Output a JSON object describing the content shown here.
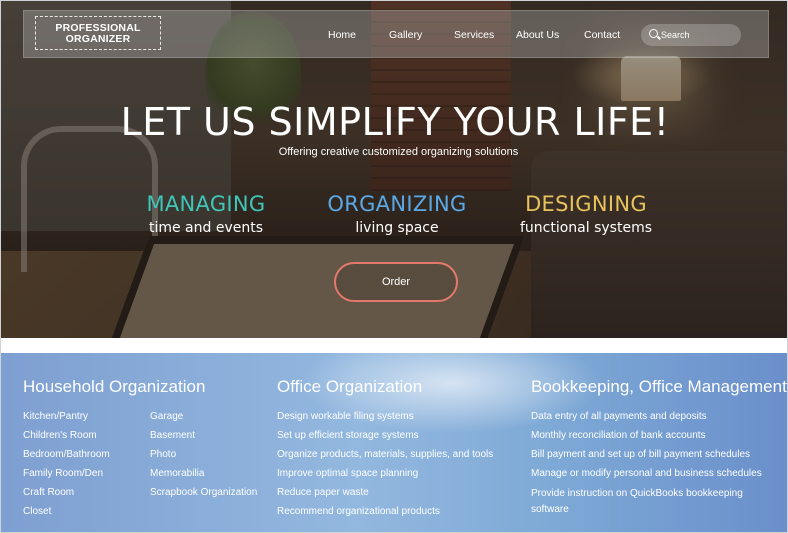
{
  "header": {
    "logo_line1": "PROFESSIONAL",
    "logo_line2": "ORGANIZER",
    "nav": [
      "Home",
      "Gallery",
      "Services",
      "About Us",
      "Contact"
    ],
    "search_placeholder": "Search"
  },
  "hero": {
    "headline": "LET US SIMPLIFY YOUR LIFE!",
    "subheadline": "Offering creative customized organizing solutions",
    "pillars": [
      {
        "title": "MANAGING",
        "subtitle": "time and events",
        "color": "#3ec7b8"
      },
      {
        "title": "ORGANIZING",
        "subtitle": "living space",
        "color": "#5aa9e6"
      },
      {
        "title": "DESIGNING",
        "subtitle": "functional systems",
        "color": "#e8c25a"
      }
    ],
    "order_label": "Order",
    "order_border_color": "#e3796c"
  },
  "services": {
    "household": {
      "title": "Household Organization",
      "col1": [
        "Kitchen/Pantry",
        "Children's Room",
        "Bedroom/Bathroom",
        "Family Room/Den",
        "Craft Room",
        "Closet"
      ],
      "col2": [
        "Garage",
        "Basement",
        "Photo",
        "Memorabilia",
        "Scrapbook Organization"
      ]
    },
    "office": {
      "title": "Office Organization",
      "items": [
        "Design workable filing systems",
        "Set up efficient storage systems",
        "Organize products, materials, supplies, and tools",
        "Improve optimal space planning",
        "Reduce paper waste",
        "Recommend organizational products"
      ]
    },
    "bookkeeping": {
      "title": "Bookkeeping, Office Management",
      "items": [
        "Data entry of all payments and deposits",
        "Monthly reconciliation of bank accounts",
        "Bill payment and set up of bill payment schedules",
        "Manage or modify personal and business schedules",
        "Provide instruction on QuickBooks bookkeeping software"
      ]
    }
  }
}
